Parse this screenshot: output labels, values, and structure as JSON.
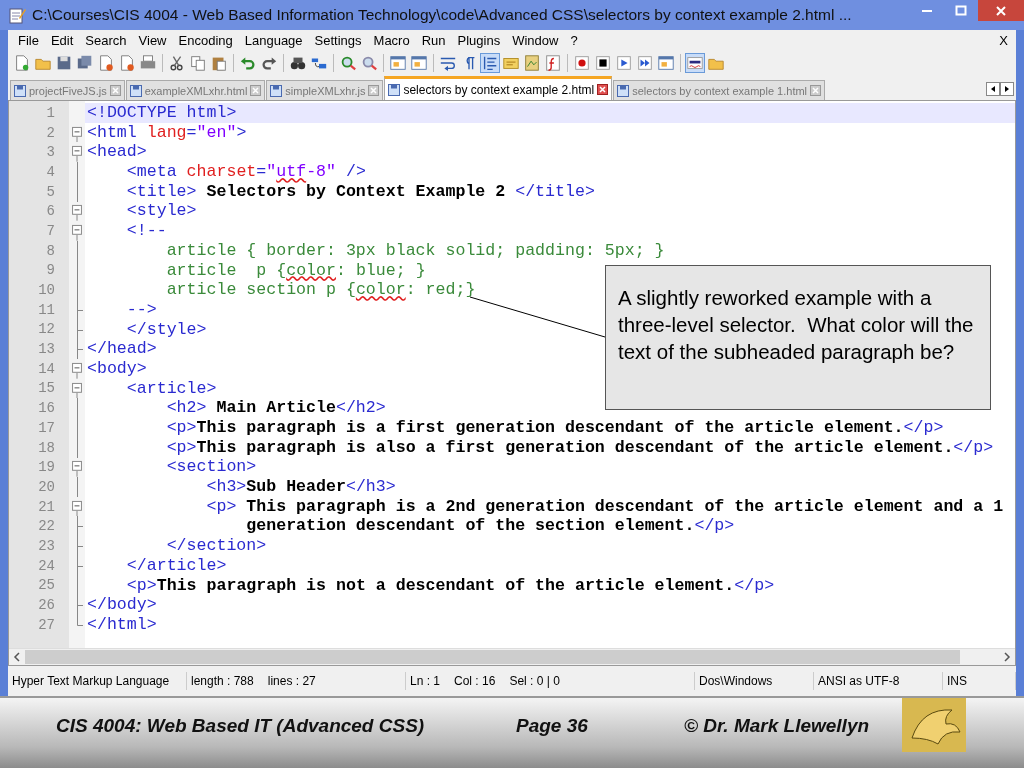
{
  "window": {
    "title": "C:\\Courses\\CIS 4004 - Web Based Information Technology\\code\\Advanced CSS\\selectors by context example 2.html ..."
  },
  "menu": {
    "items": [
      "File",
      "Edit",
      "Search",
      "View",
      "Encoding",
      "Language",
      "Settings",
      "Macro",
      "Run",
      "Plugins",
      "Window",
      "?"
    ],
    "close_document": "X"
  },
  "toolbar": [
    {
      "kind": "doc",
      "pressed": false
    },
    {
      "kind": "folder",
      "pressed": false
    },
    {
      "kind": "disk",
      "pressed": false
    },
    {
      "kind": "disks",
      "pressed": false
    },
    {
      "kind": "doc-close",
      "pressed": false
    },
    {
      "kind": "doc-close",
      "pressed": false
    },
    {
      "kind": "printer",
      "pressed": false
    },
    {
      "kind": "sep"
    },
    {
      "kind": "scissors",
      "pressed": false
    },
    {
      "kind": "pages",
      "pressed": false
    },
    {
      "kind": "clipboard",
      "pressed": false
    },
    {
      "kind": "sep"
    },
    {
      "kind": "undo",
      "pressed": false
    },
    {
      "kind": "redo",
      "pressed": false
    },
    {
      "kind": "sep"
    },
    {
      "kind": "binoculars",
      "pressed": false
    },
    {
      "kind": "replace",
      "pressed": false
    },
    {
      "kind": "sep"
    },
    {
      "kind": "zoom-in",
      "pressed": false
    },
    {
      "kind": "zoom-out",
      "pressed": false
    },
    {
      "kind": "sep"
    },
    {
      "kind": "window",
      "pressed": false
    },
    {
      "kind": "window",
      "pressed": false
    },
    {
      "kind": "sep"
    },
    {
      "kind": "wrap",
      "pressed": false
    },
    {
      "kind": "pilcrow",
      "pressed": false
    },
    {
      "kind": "guide",
      "pressed": true
    },
    {
      "kind": "note",
      "pressed": false
    },
    {
      "kind": "map",
      "pressed": false
    },
    {
      "kind": "function",
      "pressed": false
    },
    {
      "kind": "sep"
    },
    {
      "kind": "record",
      "pressed": false
    },
    {
      "kind": "stop",
      "pressed": false
    },
    {
      "kind": "play",
      "pressed": false
    },
    {
      "kind": "fast-forward",
      "pressed": false
    },
    {
      "kind": "window",
      "pressed": false
    },
    {
      "kind": "sep"
    },
    {
      "kind": "spell",
      "pressed": true
    },
    {
      "kind": "folder",
      "pressed": false
    }
  ],
  "tabs": [
    {
      "label": "projectFiveJS.js",
      "selected": false
    },
    {
      "label": "exampleXMLxhr.html",
      "selected": false
    },
    {
      "label": "simpleXMLxhr.js",
      "selected": false
    },
    {
      "label": "selectors by context example 2.html",
      "selected": true
    },
    {
      "label": "selectors by context example 1.html",
      "selected": false
    }
  ],
  "editor": {
    "lines": [
      {
        "number": "1",
        "kind": "plain",
        "current": true,
        "tokens": [
          {
            "kind": "tag",
            "text": "<!DOCTYPE html>"
          }
        ]
      },
      {
        "number": "2",
        "kind": "fold-open",
        "current": false,
        "tokens": [
          {
            "kind": "tag",
            "text": "<html "
          },
          {
            "kind": "attr",
            "text": "lang"
          },
          {
            "kind": "tag",
            "text": "="
          },
          {
            "kind": "value",
            "text": "\"en\""
          },
          {
            "kind": "tag",
            "text": ">"
          }
        ]
      },
      {
        "number": "3",
        "kind": "fold-open",
        "current": false,
        "tokens": [
          {
            "kind": "tag",
            "text": "<head>"
          }
        ]
      },
      {
        "number": "4",
        "kind": "fold-line",
        "current": false,
        "tokens": [
          {
            "kind": "tag",
            "text": "    <meta "
          },
          {
            "kind": "attr",
            "text": "charset"
          },
          {
            "kind": "tag",
            "text": "="
          },
          {
            "kind": "value",
            "text": "\""
          },
          {
            "kind": "value",
            "text": "utf",
            "spell": true
          },
          {
            "kind": "value",
            "text": "-8\""
          },
          {
            "kind": "tag",
            "text": " />"
          }
        ]
      },
      {
        "number": "5",
        "kind": "fold-line",
        "current": false,
        "tokens": [
          {
            "kind": "tag",
            "text": "    <title>"
          },
          {
            "kind": "text",
            "text": " Selectors by Context Example 2 "
          },
          {
            "kind": "tag",
            "text": "</title>"
          }
        ]
      },
      {
        "number": "6",
        "kind": "fold-open",
        "current": false,
        "tokens": [
          {
            "kind": "tag",
            "text": "    <style>"
          }
        ]
      },
      {
        "number": "7",
        "kind": "fold-open",
        "current": false,
        "tokens": [
          {
            "kind": "tag",
            "text": "    <!--"
          }
        ]
      },
      {
        "number": "8",
        "kind": "fold-line",
        "current": false,
        "tokens": [
          {
            "kind": "css",
            "text": "        article { border: 3px black solid; padding: 5px; }"
          }
        ]
      },
      {
        "number": "9",
        "kind": "fold-line",
        "current": false,
        "tokens": [
          {
            "kind": "css",
            "text": "        article  p {"
          },
          {
            "kind": "css",
            "text": "color",
            "spell": true
          },
          {
            "kind": "css",
            "text": ": blue; }"
          }
        ]
      },
      {
        "number": "10",
        "kind": "fold-line",
        "current": false,
        "tokens": [
          {
            "kind": "css",
            "text": "        article section p {"
          },
          {
            "kind": "css",
            "text": "color",
            "spell": true
          },
          {
            "kind": "css",
            "text": ": red;}"
          }
        ]
      },
      {
        "number": "11",
        "kind": "fold-tick",
        "current": false,
        "tokens": [
          {
            "kind": "tag",
            "text": "    -->"
          }
        ]
      },
      {
        "number": "12",
        "kind": "fold-tick",
        "current": false,
        "tokens": [
          {
            "kind": "tag",
            "text": "    </style>"
          }
        ]
      },
      {
        "number": "13",
        "kind": "fold-tick",
        "current": false,
        "tokens": [
          {
            "kind": "tag",
            "text": "</head>"
          }
        ]
      },
      {
        "number": "14",
        "kind": "fold-open",
        "current": false,
        "tokens": [
          {
            "kind": "tag",
            "text": "<body>"
          }
        ]
      },
      {
        "number": "15",
        "kind": "fold-open",
        "current": false,
        "tokens": [
          {
            "kind": "tag",
            "text": "    <article>"
          }
        ]
      },
      {
        "number": "16",
        "kind": "fold-line",
        "current": false,
        "tokens": [
          {
            "kind": "tag",
            "text": "        <h2>"
          },
          {
            "kind": "text",
            "text": " Main Article"
          },
          {
            "kind": "tag",
            "text": "</h2>"
          }
        ]
      },
      {
        "number": "17",
        "kind": "fold-line",
        "current": false,
        "tokens": [
          {
            "kind": "tag",
            "text": "        <p>"
          },
          {
            "kind": "text",
            "text": "This paragraph is a first generation descendant of the article element."
          },
          {
            "kind": "tag",
            "text": "</p>"
          }
        ]
      },
      {
        "number": "18",
        "kind": "fold-line",
        "current": false,
        "tokens": [
          {
            "kind": "tag",
            "text": "        <p>"
          },
          {
            "kind": "text",
            "text": "This paragraph is also a first generation descendant of the article element."
          },
          {
            "kind": "tag",
            "text": "</p>"
          }
        ]
      },
      {
        "number": "19",
        "kind": "fold-open",
        "current": false,
        "tokens": [
          {
            "kind": "tag",
            "text": "        <section>"
          }
        ]
      },
      {
        "number": "20",
        "kind": "fold-line",
        "current": false,
        "tokens": [
          {
            "kind": "tag",
            "text": "            <h3>"
          },
          {
            "kind": "text",
            "text": "Sub Header"
          },
          {
            "kind": "tag",
            "text": "</h3>"
          }
        ]
      },
      {
        "number": "21",
        "kind": "fold-open",
        "current": false,
        "tokens": [
          {
            "kind": "tag",
            "text": "            <p>"
          },
          {
            "kind": "text",
            "text": " This paragraph is a 2nd generation descendant of the article element and a 1"
          }
        ]
      },
      {
        "number": "22",
        "kind": "fold-tick",
        "current": false,
        "tokens": [
          {
            "kind": "text",
            "text": "                generation descendant of the section element."
          },
          {
            "kind": "tag",
            "text": "</p>"
          }
        ]
      },
      {
        "number": "23",
        "kind": "fold-tick",
        "current": false,
        "tokens": [
          {
            "kind": "tag",
            "text": "        </section>"
          }
        ]
      },
      {
        "number": "24",
        "kind": "fold-tick",
        "current": false,
        "tokens": [
          {
            "kind": "tag",
            "text": "    </article>"
          }
        ]
      },
      {
        "number": "25",
        "kind": "fold-line",
        "current": false,
        "tokens": [
          {
            "kind": "tag",
            "text": "    <p>"
          },
          {
            "kind": "text",
            "text": "This paragraph is not a descendant of the article element."
          },
          {
            "kind": "tag",
            "text": "</p>"
          }
        ]
      },
      {
        "number": "26",
        "kind": "fold-tick",
        "current": false,
        "tokens": [
          {
            "kind": "tag",
            "text": "</body>"
          }
        ]
      },
      {
        "number": "27",
        "kind": "fold-close",
        "current": false,
        "tokens": [
          {
            "kind": "tag",
            "text": "</html>"
          }
        ]
      }
    ]
  },
  "callout": {
    "text": "A slightly reworked example with a three-level selector.  What color will the text of the subheaded paragraph be?"
  },
  "status_bar": [
    {
      "parts": [
        "Hyper Text Markup Language"
      ]
    },
    {
      "parts": [
        "length : 788",
        "lines : 27"
      ]
    },
    {
      "parts": [
        "Ln : 1",
        "Col : 16",
        "Sel : 0 | 0"
      ]
    },
    {
      "parts": [
        "Dos\\Windows"
      ]
    },
    {
      "parts": [
        "ANSI as UTF-8"
      ]
    },
    {
      "parts": [
        "INS"
      ]
    }
  ],
  "footer": {
    "course": "CIS 4004: Web Based IT (Advanced CSS)",
    "page": "Page 36",
    "author": "© Dr. Mark Llewellyn"
  }
}
